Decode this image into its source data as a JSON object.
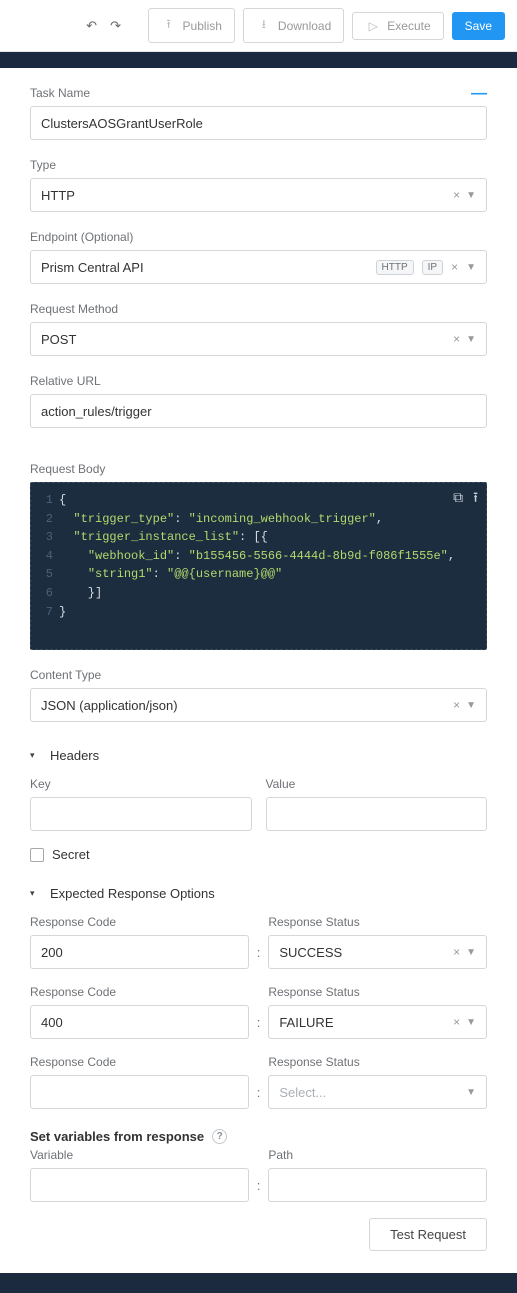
{
  "toolbar": {
    "publish_label": "Publish",
    "download_label": "Download",
    "execute_label": "Execute",
    "save_label": "Save"
  },
  "fields": {
    "task_name_label": "Task Name",
    "task_name_value": "ClustersAOSGrantUserRole",
    "type_label": "Type",
    "type_value": "HTTP",
    "endpoint_label": "Endpoint (Optional)",
    "endpoint_value": "Prism Central API",
    "endpoint_pill_proto": "HTTP",
    "endpoint_pill_addr": "IP",
    "method_label": "Request Method",
    "method_value": "POST",
    "relurl_label": "Relative URL",
    "relurl_value": "action_rules/trigger",
    "body_label": "Request Body",
    "content_type_label": "Content Type",
    "content_type_value": "JSON (application/json)"
  },
  "code": {
    "gutter": [
      "1",
      "2",
      "3",
      "4",
      "5",
      "6",
      "7"
    ],
    "lines": [
      {
        "text": "{",
        "cls": "tok-punc"
      },
      {
        "key": "\"trigger_type\"",
        "val": "\"incoming_webhook_trigger\"",
        "trail": ","
      },
      {
        "key": "\"trigger_instance_list\"",
        "valpunc": "[{"
      },
      {
        "indent": "    ",
        "key": "\"webhook_id\"",
        "val": "\"b155456-5566-4444d-8b9d-f086f1555e\"",
        "trail": ","
      },
      {
        "indent": "    ",
        "key": "\"string1\"",
        "val": "\"@@{username}@@\""
      },
      {
        "text": "    }]",
        "cls": "tok-punc"
      },
      {
        "text": "}",
        "cls": "tok-punc"
      }
    ]
  },
  "headers_section": {
    "title": "Headers",
    "key_label": "Key",
    "value_label": "Value",
    "secret_label": "Secret"
  },
  "response_section": {
    "title": "Expected Response Options",
    "code_label": "Response Code",
    "status_label": "Response Status",
    "rows": [
      {
        "code": "200",
        "status": "SUCCESS"
      },
      {
        "code": "400",
        "status": "FAILURE"
      },
      {
        "code": "",
        "status": "",
        "placeholder": "Select..."
      }
    ]
  },
  "vars_section": {
    "title": "Set variables from response",
    "variable_label": "Variable",
    "path_label": "Path"
  },
  "test_btn_label": "Test Request"
}
